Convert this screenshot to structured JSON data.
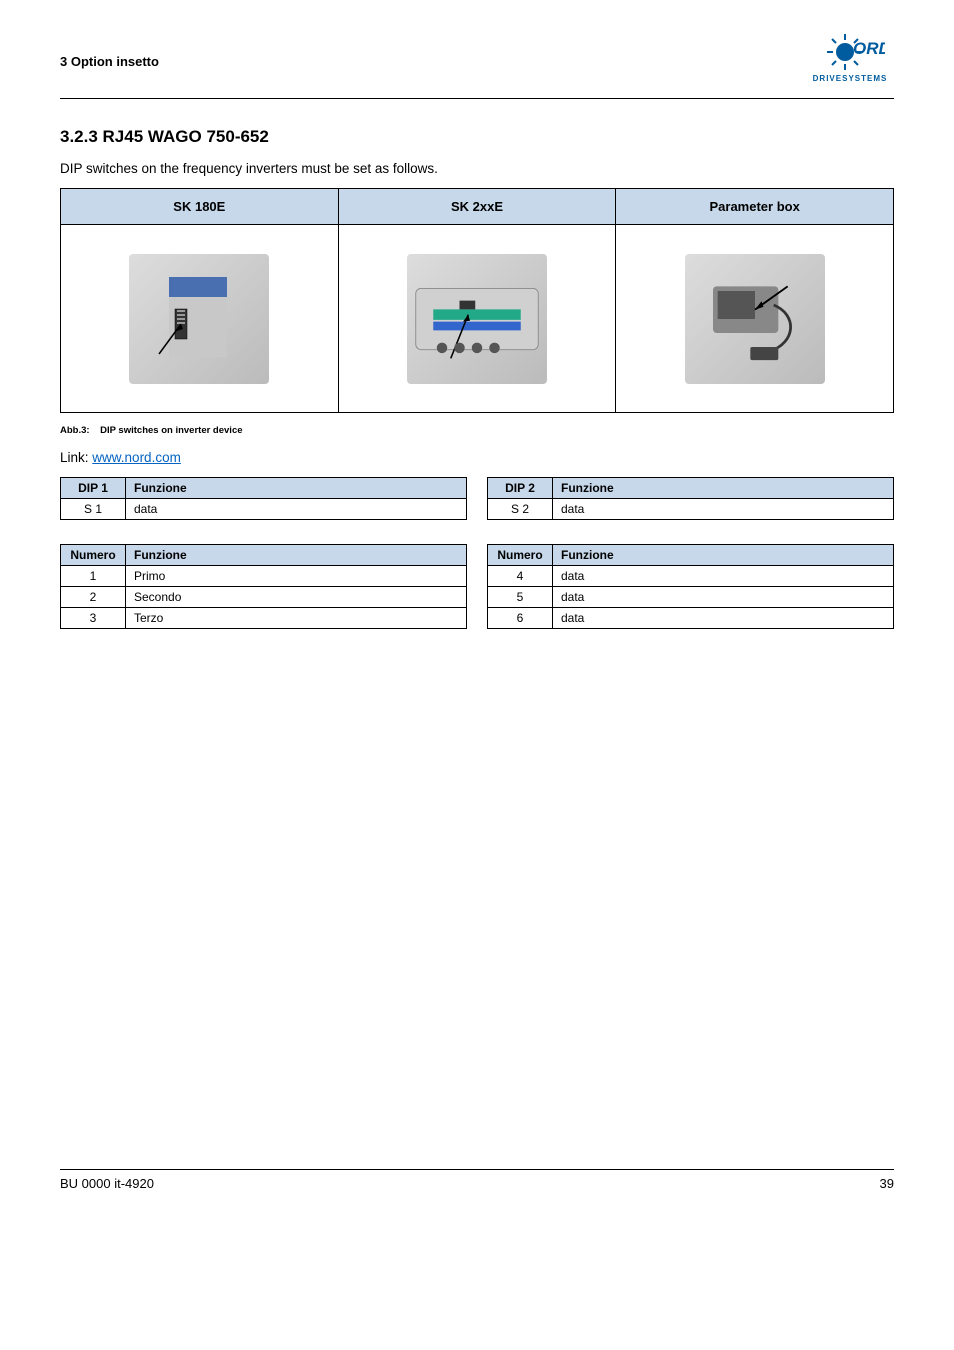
{
  "header": {
    "title": "3 Option insetto",
    "logo_top": "NORD",
    "logo_bottom": "DRIVESYSTEMS"
  },
  "section": {
    "number_title": "3.2.3 RJ45 WAGO 750-652",
    "para1": "DIP switches on the frequency inverters must be set as follows.",
    "image_table": {
      "headers": [
        "SK 180E",
        "SK 2xxE",
        "Parameter box"
      ],
      "alts": [
        "SK 180E DIP switches",
        "SK 2xxE DIP switches",
        "Parameter box (8Z_br)"
      ]
    },
    "caption_label": "Abb.3:",
    "caption_text": "DIP switches on inverter device",
    "link_label": "Link:",
    "link_text": "www.nord.com",
    "first_tables": {
      "left": {
        "headers": [
          "DIP 1",
          "Funzione"
        ],
        "rows": [
          [
            "S 1",
            "data"
          ]
        ]
      },
      "right": {
        "headers": [
          "DIP 2",
          "Funzione"
        ],
        "rows": [
          [
            "S 2",
            "data"
          ]
        ]
      }
    },
    "second_tables": {
      "left": {
        "headers": [
          "Numero",
          "Funzione"
        ],
        "rows": [
          [
            "1",
            "Primo"
          ],
          [
            "2",
            "Secondo"
          ],
          [
            "3",
            "Terzo"
          ]
        ]
      },
      "right": {
        "headers": [
          "Numero",
          "Funzione"
        ],
        "rows": [
          [
            "4",
            "data"
          ],
          [
            "5",
            "data"
          ],
          [
            "6",
            "data"
          ]
        ]
      }
    }
  },
  "footer": {
    "left": "BU 0000 it-4920",
    "right": "39"
  }
}
